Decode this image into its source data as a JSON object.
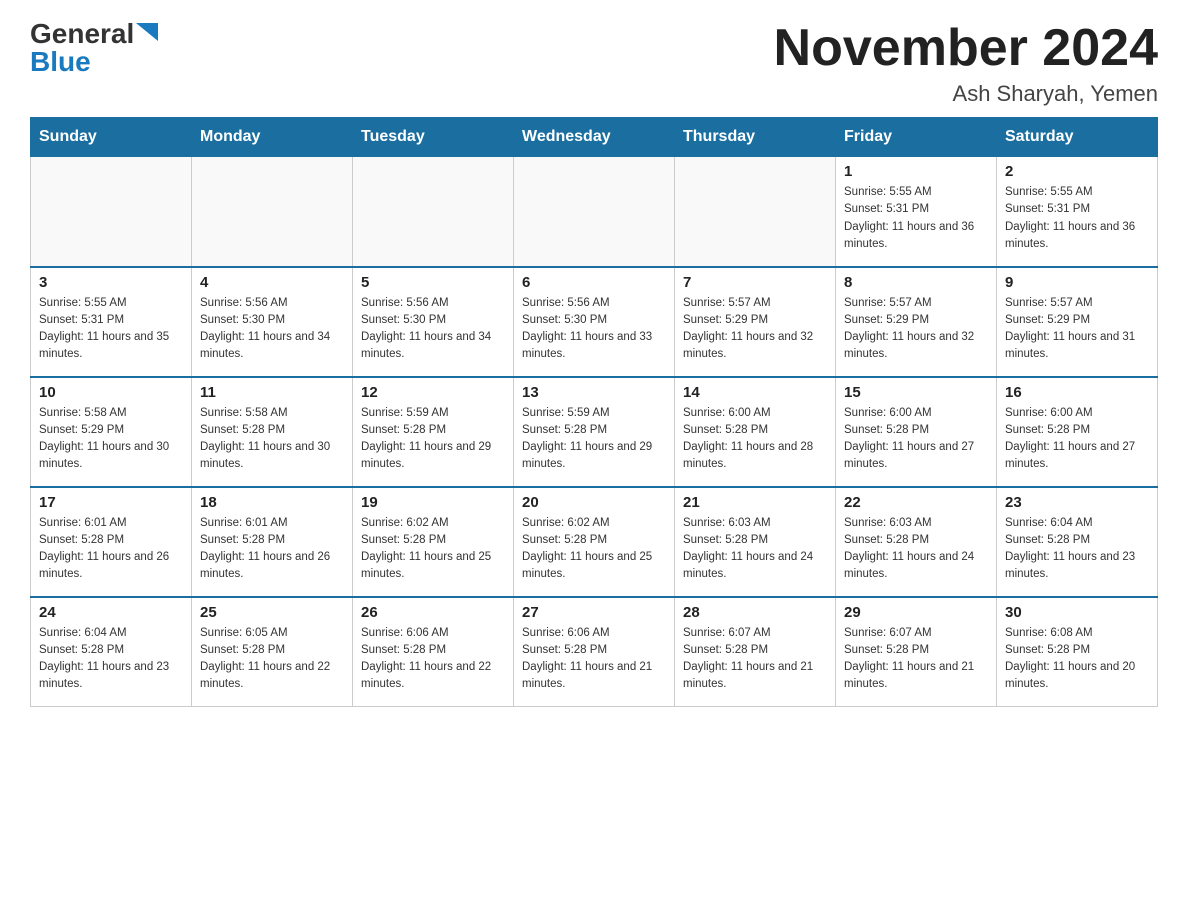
{
  "header": {
    "logo_general": "General",
    "logo_blue": "Blue",
    "month_title": "November 2024",
    "location": "Ash Sharyah, Yemen"
  },
  "days_of_week": [
    "Sunday",
    "Monday",
    "Tuesday",
    "Wednesday",
    "Thursday",
    "Friday",
    "Saturday"
  ],
  "weeks": [
    [
      {
        "day": "",
        "sunrise": "",
        "sunset": "",
        "daylight": ""
      },
      {
        "day": "",
        "sunrise": "",
        "sunset": "",
        "daylight": ""
      },
      {
        "day": "",
        "sunrise": "",
        "sunset": "",
        "daylight": ""
      },
      {
        "day": "",
        "sunrise": "",
        "sunset": "",
        "daylight": ""
      },
      {
        "day": "",
        "sunrise": "",
        "sunset": "",
        "daylight": ""
      },
      {
        "day": "1",
        "sunrise": "Sunrise: 5:55 AM",
        "sunset": "Sunset: 5:31 PM",
        "daylight": "Daylight: 11 hours and 36 minutes."
      },
      {
        "day": "2",
        "sunrise": "Sunrise: 5:55 AM",
        "sunset": "Sunset: 5:31 PM",
        "daylight": "Daylight: 11 hours and 36 minutes."
      }
    ],
    [
      {
        "day": "3",
        "sunrise": "Sunrise: 5:55 AM",
        "sunset": "Sunset: 5:31 PM",
        "daylight": "Daylight: 11 hours and 35 minutes."
      },
      {
        "day": "4",
        "sunrise": "Sunrise: 5:56 AM",
        "sunset": "Sunset: 5:30 PM",
        "daylight": "Daylight: 11 hours and 34 minutes."
      },
      {
        "day": "5",
        "sunrise": "Sunrise: 5:56 AM",
        "sunset": "Sunset: 5:30 PM",
        "daylight": "Daylight: 11 hours and 34 minutes."
      },
      {
        "day": "6",
        "sunrise": "Sunrise: 5:56 AM",
        "sunset": "Sunset: 5:30 PM",
        "daylight": "Daylight: 11 hours and 33 minutes."
      },
      {
        "day": "7",
        "sunrise": "Sunrise: 5:57 AM",
        "sunset": "Sunset: 5:29 PM",
        "daylight": "Daylight: 11 hours and 32 minutes."
      },
      {
        "day": "8",
        "sunrise": "Sunrise: 5:57 AM",
        "sunset": "Sunset: 5:29 PM",
        "daylight": "Daylight: 11 hours and 32 minutes."
      },
      {
        "day": "9",
        "sunrise": "Sunrise: 5:57 AM",
        "sunset": "Sunset: 5:29 PM",
        "daylight": "Daylight: 11 hours and 31 minutes."
      }
    ],
    [
      {
        "day": "10",
        "sunrise": "Sunrise: 5:58 AM",
        "sunset": "Sunset: 5:29 PM",
        "daylight": "Daylight: 11 hours and 30 minutes."
      },
      {
        "day": "11",
        "sunrise": "Sunrise: 5:58 AM",
        "sunset": "Sunset: 5:28 PM",
        "daylight": "Daylight: 11 hours and 30 minutes."
      },
      {
        "day": "12",
        "sunrise": "Sunrise: 5:59 AM",
        "sunset": "Sunset: 5:28 PM",
        "daylight": "Daylight: 11 hours and 29 minutes."
      },
      {
        "day": "13",
        "sunrise": "Sunrise: 5:59 AM",
        "sunset": "Sunset: 5:28 PM",
        "daylight": "Daylight: 11 hours and 29 minutes."
      },
      {
        "day": "14",
        "sunrise": "Sunrise: 6:00 AM",
        "sunset": "Sunset: 5:28 PM",
        "daylight": "Daylight: 11 hours and 28 minutes."
      },
      {
        "day": "15",
        "sunrise": "Sunrise: 6:00 AM",
        "sunset": "Sunset: 5:28 PM",
        "daylight": "Daylight: 11 hours and 27 minutes."
      },
      {
        "day": "16",
        "sunrise": "Sunrise: 6:00 AM",
        "sunset": "Sunset: 5:28 PM",
        "daylight": "Daylight: 11 hours and 27 minutes."
      }
    ],
    [
      {
        "day": "17",
        "sunrise": "Sunrise: 6:01 AM",
        "sunset": "Sunset: 5:28 PM",
        "daylight": "Daylight: 11 hours and 26 minutes."
      },
      {
        "day": "18",
        "sunrise": "Sunrise: 6:01 AM",
        "sunset": "Sunset: 5:28 PM",
        "daylight": "Daylight: 11 hours and 26 minutes."
      },
      {
        "day": "19",
        "sunrise": "Sunrise: 6:02 AM",
        "sunset": "Sunset: 5:28 PM",
        "daylight": "Daylight: 11 hours and 25 minutes."
      },
      {
        "day": "20",
        "sunrise": "Sunrise: 6:02 AM",
        "sunset": "Sunset: 5:28 PM",
        "daylight": "Daylight: 11 hours and 25 minutes."
      },
      {
        "day": "21",
        "sunrise": "Sunrise: 6:03 AM",
        "sunset": "Sunset: 5:28 PM",
        "daylight": "Daylight: 11 hours and 24 minutes."
      },
      {
        "day": "22",
        "sunrise": "Sunrise: 6:03 AM",
        "sunset": "Sunset: 5:28 PM",
        "daylight": "Daylight: 11 hours and 24 minutes."
      },
      {
        "day": "23",
        "sunrise": "Sunrise: 6:04 AM",
        "sunset": "Sunset: 5:28 PM",
        "daylight": "Daylight: 11 hours and 23 minutes."
      }
    ],
    [
      {
        "day": "24",
        "sunrise": "Sunrise: 6:04 AM",
        "sunset": "Sunset: 5:28 PM",
        "daylight": "Daylight: 11 hours and 23 minutes."
      },
      {
        "day": "25",
        "sunrise": "Sunrise: 6:05 AM",
        "sunset": "Sunset: 5:28 PM",
        "daylight": "Daylight: 11 hours and 22 minutes."
      },
      {
        "day": "26",
        "sunrise": "Sunrise: 6:06 AM",
        "sunset": "Sunset: 5:28 PM",
        "daylight": "Daylight: 11 hours and 22 minutes."
      },
      {
        "day": "27",
        "sunrise": "Sunrise: 6:06 AM",
        "sunset": "Sunset: 5:28 PM",
        "daylight": "Daylight: 11 hours and 21 minutes."
      },
      {
        "day": "28",
        "sunrise": "Sunrise: 6:07 AM",
        "sunset": "Sunset: 5:28 PM",
        "daylight": "Daylight: 11 hours and 21 minutes."
      },
      {
        "day": "29",
        "sunrise": "Sunrise: 6:07 AM",
        "sunset": "Sunset: 5:28 PM",
        "daylight": "Daylight: 11 hours and 21 minutes."
      },
      {
        "day": "30",
        "sunrise": "Sunrise: 6:08 AM",
        "sunset": "Sunset: 5:28 PM",
        "daylight": "Daylight: 11 hours and 20 minutes."
      }
    ]
  ]
}
